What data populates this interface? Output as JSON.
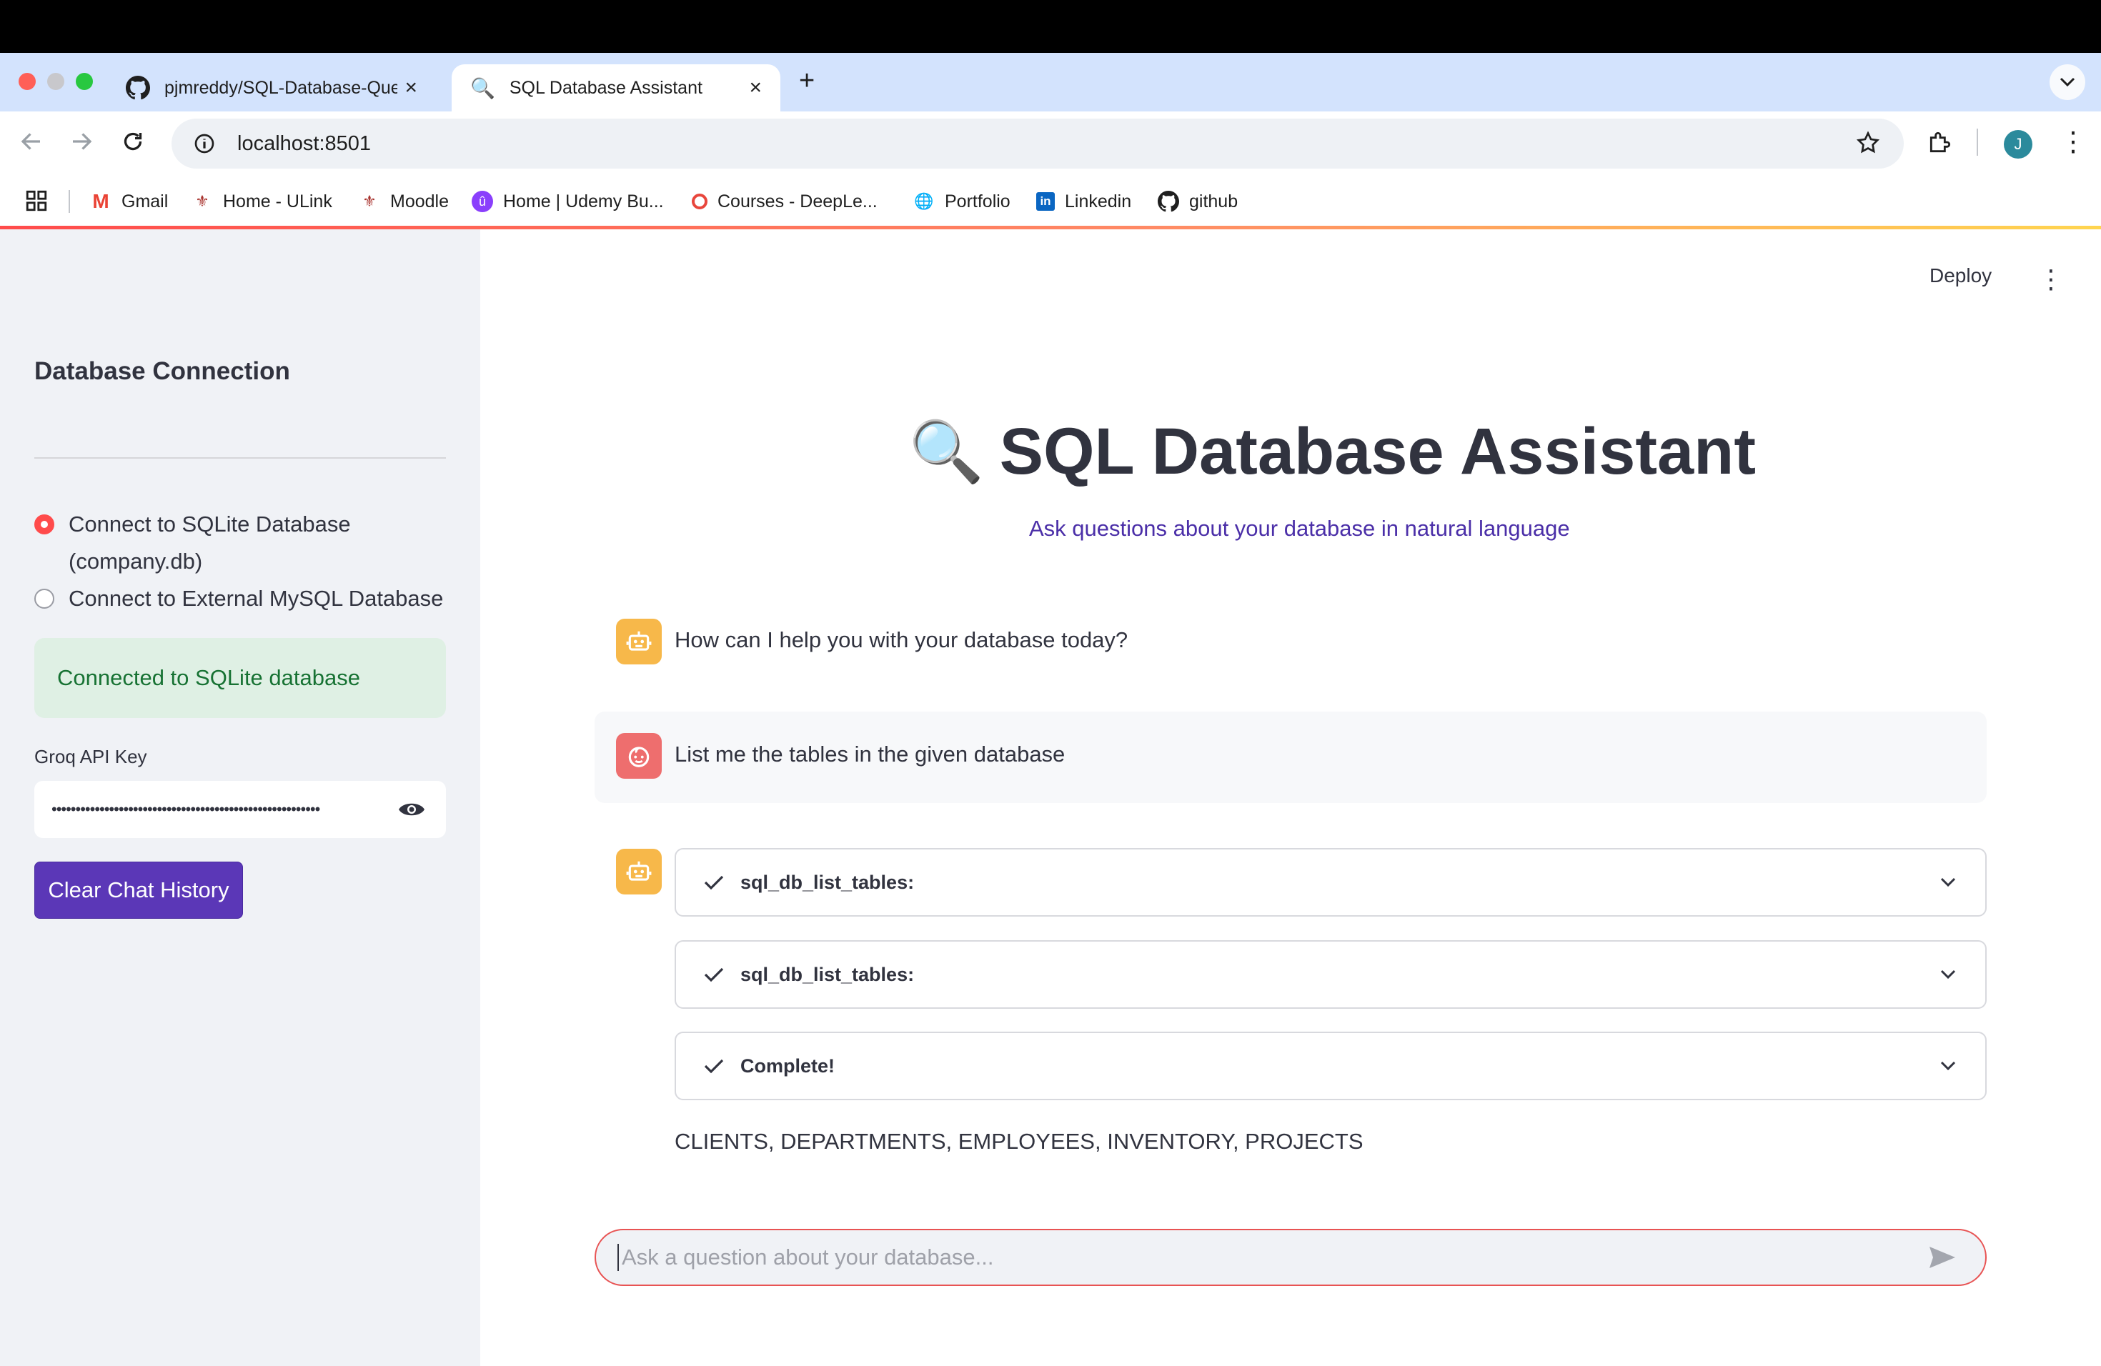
{
  "browser": {
    "tabs": [
      {
        "title": "pjmreddy/SQL-Database-Que",
        "icon": "github-icon",
        "active": false
      },
      {
        "title": "SQL Database Assistant",
        "icon": "magnifier-icon",
        "active": true
      }
    ],
    "new_tab": "+",
    "url": "localhost:8501",
    "profile_initial": "J",
    "bookmarks": [
      "Gmail",
      "Home - ULink",
      "Moodle",
      "Home | Udemy Bu...",
      "Courses - DeepLe...",
      "Portfolio",
      "Linkedin",
      "github"
    ]
  },
  "sidebar": {
    "title": "Database Connection",
    "radio_options": [
      {
        "label_line1": "Connect to SQLite Database",
        "label_line2": "(company.db)",
        "selected": true
      },
      {
        "label_line1": "Connect to External MySQL Database",
        "label_line2": "",
        "selected": false
      }
    ],
    "status_message": "Connected to SQLite database",
    "api_key_label": "Groq API Key",
    "api_key_masked": "••••••••••••••••••••••••••••••••••••••••••••••••••••••••",
    "clear_button": "Clear Chat History"
  },
  "header": {
    "deploy": "Deploy",
    "menu_glyph": "⋮"
  },
  "main": {
    "title_icon": "🔍",
    "title": "SQL Database Assistant",
    "subtitle": "Ask questions about your database in natural language",
    "messages": [
      {
        "role": "assistant",
        "text": "How can I help you with your database today?"
      },
      {
        "role": "user",
        "text": "List me the tables in the given database"
      }
    ],
    "steps": [
      {
        "label": "sql_db_list_tables:",
        "status": "complete"
      },
      {
        "label": "sql_db_list_tables:",
        "status": "complete"
      },
      {
        "label": "Complete!",
        "status": "complete"
      }
    ],
    "answer": "CLIENTS, DEPARTMENTS, EMPLOYEES, INVENTORY, PROJECTS",
    "chat_placeholder": "Ask a question about your database..."
  },
  "colors": {
    "accent": "#ff4b4b",
    "primary_button": "#5b37b7",
    "success_bg": "#dff0e4",
    "success_text": "#177233",
    "bot_avatar": "#f7b84a",
    "user_avatar": "#ee6e6e"
  }
}
